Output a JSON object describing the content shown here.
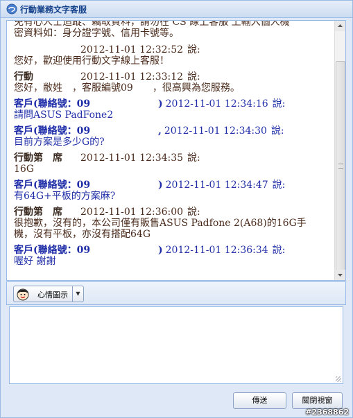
{
  "window": {
    "title": "行動業務文字客服"
  },
  "chat": {
    "notice_lines": [
      "免有心人士追蹤、竊取資料，請勿在 CS 線上客服 上輸入個人機",
      "密資料如：身分證字號、信用卡號等。"
    ],
    "messages": [
      {
        "role": "agent",
        "sender": "",
        "timestamp": "2012-11-01 12:32:52",
        "said": "說:",
        "lines": [
          "您好，歡迎使用行動文字線上客服！"
        ]
      },
      {
        "role": "agent",
        "sender": "行動",
        "timestamp": "2012-11-01 12:33:12",
        "said": "說:",
        "lines": [
          "您好，敝姓　，客服編號09　　，很高興為您服務。"
        ]
      },
      {
        "role": "customer",
        "sender": "客戶(聯絡號：09",
        "sender_end": ")",
        "timestamp": "2012-11-01 12:34:16",
        "said": "說:",
        "lines": [
          "請問ASUS PadFone2"
        ]
      },
      {
        "role": "customer",
        "sender": "客戶(聯絡號：09",
        "sender_end": ",",
        "timestamp": "2012-11-01 12:34:30",
        "said": "說:",
        "lines": [
          "目前方案是多少G的?"
        ]
      },
      {
        "role": "agent",
        "sender": "行動第　席",
        "timestamp": "2012-11-01 12:34:35",
        "said": "說:",
        "lines": [
          "16G"
        ]
      },
      {
        "role": "customer",
        "sender": "客戶(聯絡號：09",
        "sender_end": ")",
        "timestamp": "2012-11-01 12:34:47",
        "said": "說:",
        "lines": [
          "有64G+平板的方案麻?"
        ]
      },
      {
        "role": "agent",
        "sender": "行動第　席",
        "timestamp": "2012-11-01 12:36:00",
        "said": "說:",
        "lines": [
          "很抱歉，沒有的，本公司僅有販售ASUS Padfone 2(A68)的16G手",
          "機，沒有平板，亦沒有搭配64G"
        ]
      },
      {
        "role": "customer",
        "sender": "客戶(聯絡號：09",
        "sender_end": ")",
        "timestamp": "2012-11-01 12:36:34",
        "said": "說:",
        "lines": [
          "喔好 謝謝"
        ]
      }
    ]
  },
  "toolbar": {
    "mood_label": "心情圖示",
    "mood_icon": "smiley-face-icon"
  },
  "input": {
    "value": "",
    "placeholder": ""
  },
  "buttons": {
    "send_label": "傳送",
    "close_label": "關閉視窗"
  },
  "watermark": "#2368862",
  "colors": {
    "agent_text": "#4a2a1a",
    "customer_text": "#1f2ea8",
    "window_bg": "#dfe8f6",
    "border": "#99bbe8",
    "title_text": "#15428b"
  }
}
